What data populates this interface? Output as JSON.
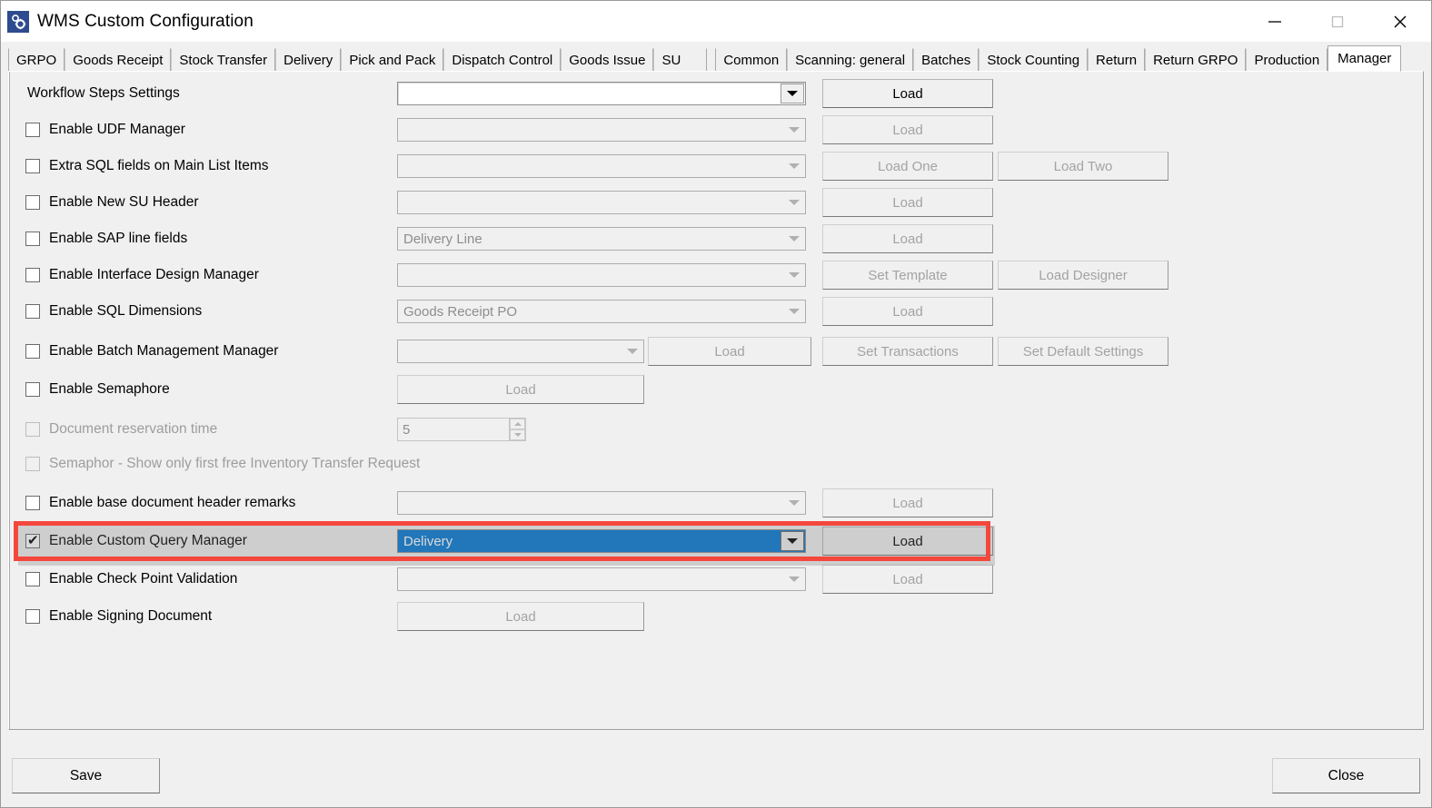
{
  "window": {
    "title": "WMS Custom Configuration",
    "icon": "gears-icon",
    "caption_buttons": [
      {
        "name": "minimize",
        "glyph": "minimize-icon",
        "enabled": true
      },
      {
        "name": "maximize",
        "glyph": "maximize-icon",
        "enabled": false
      },
      {
        "name": "close",
        "glyph": "close-icon",
        "enabled": true
      }
    ]
  },
  "tabs": {
    "selected": "Manager",
    "items": [
      {
        "label": "GRPO"
      },
      {
        "label": "Goods Receipt"
      },
      {
        "label": "Stock Transfer"
      },
      {
        "label": "Delivery"
      },
      {
        "label": "Pick and Pack"
      },
      {
        "label": "Dispatch Control"
      },
      {
        "label": "Goods Issue"
      },
      {
        "label": "SU"
      },
      {
        "label": "Common"
      },
      {
        "label": "Scanning: general"
      },
      {
        "label": "Batches"
      },
      {
        "label": "Stock Counting"
      },
      {
        "label": "Return"
      },
      {
        "label": "Return GRPO"
      },
      {
        "label": "Production"
      },
      {
        "label": "Manager"
      }
    ]
  },
  "manager": {
    "rows": [
      {
        "id": "workflow-steps-settings",
        "label": "Workflow Steps Settings",
        "has_checkbox": false,
        "checked": false,
        "label_disabled": false,
        "combo": {
          "value": "",
          "enabled": true,
          "selected": false
        },
        "buttons": [
          {
            "label": "Load",
            "enabled": true
          }
        ]
      },
      {
        "id": "enable-udf-manager",
        "label": "Enable UDF Manager",
        "has_checkbox": true,
        "checked": false,
        "label_disabled": false,
        "combo": {
          "value": "",
          "enabled": false,
          "selected": false
        },
        "buttons": [
          {
            "label": "Load",
            "enabled": false
          }
        ]
      },
      {
        "id": "extra-sql-fields-main-list-items",
        "label": "Extra SQL fields on Main List Items",
        "has_checkbox": true,
        "checked": false,
        "label_disabled": false,
        "combo": {
          "value": "",
          "enabled": false,
          "selected": false
        },
        "buttons": [
          {
            "label": "Load One",
            "enabled": false
          },
          {
            "label": "Load Two",
            "enabled": false
          }
        ]
      },
      {
        "id": "enable-new-su-header",
        "label": "Enable New SU Header",
        "has_checkbox": true,
        "checked": false,
        "label_disabled": false,
        "combo": {
          "value": "",
          "enabled": false,
          "selected": false
        },
        "buttons": [
          {
            "label": "Load",
            "enabled": false
          }
        ]
      },
      {
        "id": "enable-sap-line-fields",
        "label": "Enable SAP line fields",
        "has_checkbox": true,
        "checked": false,
        "label_disabled": false,
        "combo": {
          "value": "Delivery Line",
          "enabled": false,
          "selected": false
        },
        "buttons": [
          {
            "label": "Load",
            "enabled": false
          }
        ]
      },
      {
        "id": "enable-interface-design-manager",
        "label": "Enable Interface Design Manager",
        "has_checkbox": true,
        "checked": false,
        "label_disabled": false,
        "combo": {
          "value": "",
          "enabled": false,
          "selected": false
        },
        "buttons": [
          {
            "label": "Set Template",
            "enabled": false
          },
          {
            "label": "Load Designer",
            "enabled": false
          }
        ]
      },
      {
        "id": "enable-sql-dimensions",
        "label": "Enable SQL Dimensions",
        "has_checkbox": true,
        "checked": false,
        "label_disabled": false,
        "combo": {
          "value": "Goods Receipt PO",
          "enabled": false,
          "selected": false
        },
        "buttons": [
          {
            "label": "Load",
            "enabled": false
          }
        ]
      },
      {
        "id": "enable-batch-management-manager",
        "label": "Enable Batch Management Manager",
        "has_checkbox": true,
        "checked": false,
        "label_disabled": false,
        "combo": {
          "value": "",
          "enabled": false,
          "selected": false,
          "narrow": true
        },
        "buttons": [
          {
            "label": "Load",
            "enabled": false
          },
          {
            "label": "Set Transactions",
            "enabled": false
          },
          {
            "label": "Set Default Settings",
            "enabled": false
          }
        ]
      },
      {
        "id": "enable-semaphore",
        "label": "Enable Semaphore",
        "has_checkbox": true,
        "checked": false,
        "label_disabled": false,
        "combo": null,
        "buttons": [
          {
            "label": "Load",
            "enabled": false
          }
        ]
      },
      {
        "id": "document-reservation-time",
        "label": "Document reservation time",
        "has_checkbox": true,
        "checked": false,
        "label_disabled": true,
        "spinner": {
          "value": "5",
          "enabled": false
        },
        "buttons": []
      },
      {
        "id": "semaphor-show-only-first-free-inventory-transfer-request",
        "label": "Semaphor - Show only first free Inventory Transfer Request",
        "has_checkbox": true,
        "checked": false,
        "label_disabled": true,
        "combo": null,
        "buttons": []
      },
      {
        "id": "enable-base-document-header-remarks",
        "label": "Enable base document header remarks",
        "has_checkbox": true,
        "checked": false,
        "label_disabled": false,
        "combo": {
          "value": "",
          "enabled": false,
          "selected": false
        },
        "buttons": [
          {
            "label": "Load",
            "enabled": false
          }
        ]
      },
      {
        "id": "enable-custom-query-manager",
        "label": "Enable Custom Query Manager",
        "has_checkbox": true,
        "checked": true,
        "label_disabled": false,
        "highlighted": true,
        "combo": {
          "value": "Delivery",
          "enabled": true,
          "selected": true
        },
        "buttons": [
          {
            "label": "Load",
            "enabled": true
          }
        ]
      },
      {
        "id": "enable-check-point-validation",
        "label": "Enable Check Point Validation",
        "has_checkbox": true,
        "checked": false,
        "label_disabled": false,
        "combo": {
          "value": "",
          "enabled": false,
          "selected": false
        },
        "buttons": [
          {
            "label": "Load",
            "enabled": false
          }
        ]
      },
      {
        "id": "enable-signing-document",
        "label": "Enable Signing Document",
        "has_checkbox": true,
        "checked": false,
        "label_disabled": false,
        "combo": null,
        "buttons": [
          {
            "label": "Load",
            "enabled": false
          }
        ]
      }
    ]
  },
  "footer": {
    "save_label": "Save",
    "close_label": "Close"
  },
  "colors": {
    "selection_blue": "#0078D4",
    "annotation_red": "#F4473C",
    "window_face": "#F0F0F0",
    "icon_blue": "#2D4B8E"
  }
}
